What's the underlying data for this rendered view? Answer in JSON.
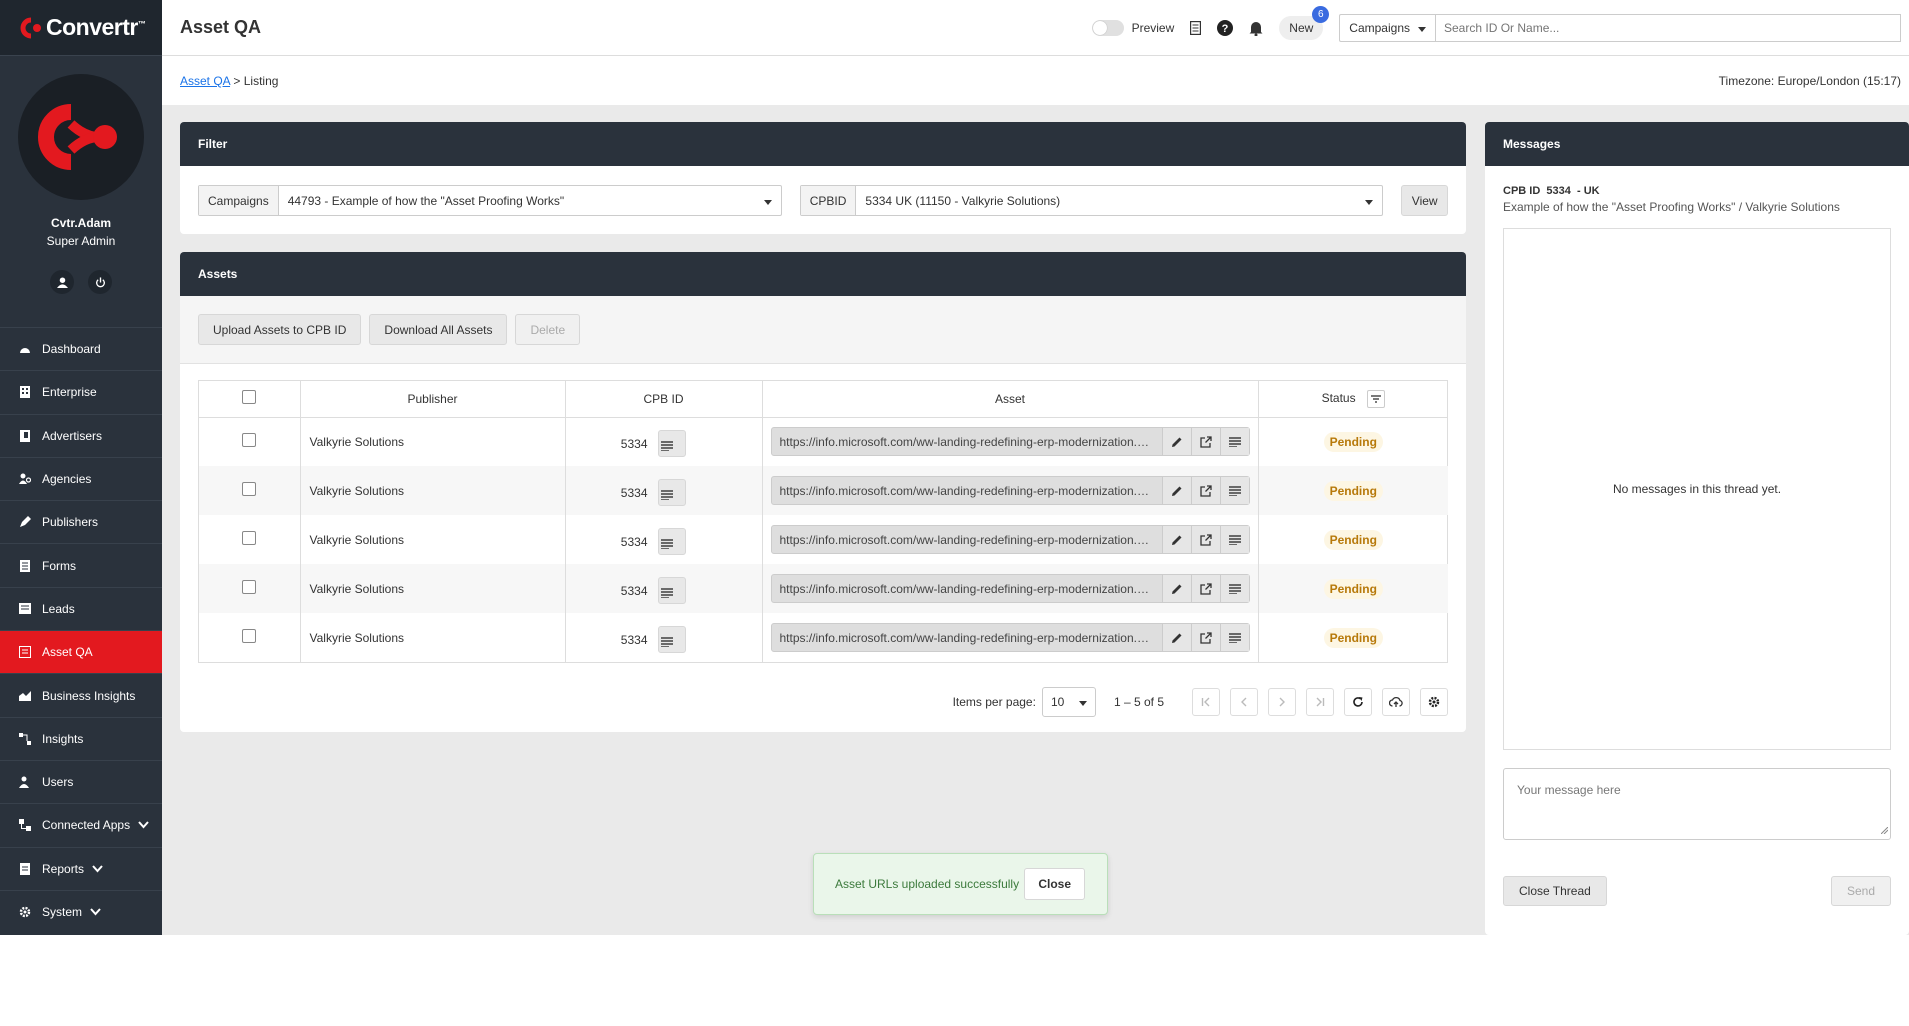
{
  "app": {
    "logo_text": "Convertr",
    "logo_tm": "™",
    "brand_color": "#e3191f",
    "sidebar_color": "#2a323c"
  },
  "user": {
    "name": "Cvtr.Adam",
    "role": "Super Admin"
  },
  "nav": {
    "dashboard": "Dashboard",
    "enterprise": "Enterprise",
    "advertisers": "Advertisers",
    "agencies": "Agencies",
    "publishers": "Publishers",
    "forms": "Forms",
    "leads": "Leads",
    "asset_qa": "Asset QA",
    "business_insights": "Business Insights",
    "insights": "Insights",
    "users": "Users",
    "connected_apps": "Connected Apps",
    "reports": "Reports",
    "system": "System"
  },
  "topbar": {
    "title": "Asset QA",
    "preview_label": "Preview",
    "new_label": "New",
    "new_count": "6",
    "campaigns_select": "Campaigns",
    "search_placeholder": "Search ID Or Name..."
  },
  "breadcrumb": {
    "link": "Asset QA",
    "separator": ">",
    "current": "Listing"
  },
  "timezone": "Timezone: Europe/London (15:17)",
  "filter": {
    "header": "Filter",
    "campaigns_label": "Campaigns",
    "campaigns_value": "44793 - Example of how the \"Asset Proofing Works\"",
    "cpbid_label": "CPBID",
    "cpbid_value": "5334 UK (11150 - Valkyrie Solutions)",
    "view_button": "View"
  },
  "assets": {
    "header": "Assets",
    "upload_button": "Upload Assets to CPB ID",
    "download_button": "Download All Assets",
    "delete_button": "Delete",
    "columns": {
      "publisher": "Publisher",
      "cpb_id": "CPB ID",
      "asset": "Asset",
      "status": "Status"
    },
    "rows": [
      {
        "publisher": "Valkyrie Solutions",
        "cpb_id": "5334",
        "asset": "https://info.microsoft.com/ww-landing-redefining-erp-modernization.html",
        "status": "Pending"
      },
      {
        "publisher": "Valkyrie Solutions",
        "cpb_id": "5334",
        "asset": "https://info.microsoft.com/ww-landing-redefining-erp-modernization.html",
        "status": "Pending"
      },
      {
        "publisher": "Valkyrie Solutions",
        "cpb_id": "5334",
        "asset": "https://info.microsoft.com/ww-landing-redefining-erp-modernization.html",
        "status": "Pending"
      },
      {
        "publisher": "Valkyrie Solutions",
        "cpb_id": "5334",
        "asset": "https://info.microsoft.com/ww-landing-redefining-erp-modernization.html",
        "status": "Pending"
      },
      {
        "publisher": "Valkyrie Solutions",
        "cpb_id": "5334",
        "asset": "https://info.microsoft.com/ww-landing-redefining-erp-modernization.html",
        "status": "Pending"
      }
    ],
    "pager": {
      "items_per_page_label": "Items per page:",
      "items_per_page": "10",
      "range": "1 – 5 of 5"
    }
  },
  "messages": {
    "header": "Messages",
    "cpb_line": "CPB ID  5334  - UK",
    "subtitle": "Example of how the \"Asset Proofing Works\" / Valkyrie Solutions",
    "empty_text": "No messages in this thread yet.",
    "input_placeholder": "Your message here",
    "close_thread_button": "Close Thread",
    "send_button": "Send"
  },
  "toast": {
    "message": "Asset URLs uploaded successfully",
    "close_button": "Close"
  }
}
